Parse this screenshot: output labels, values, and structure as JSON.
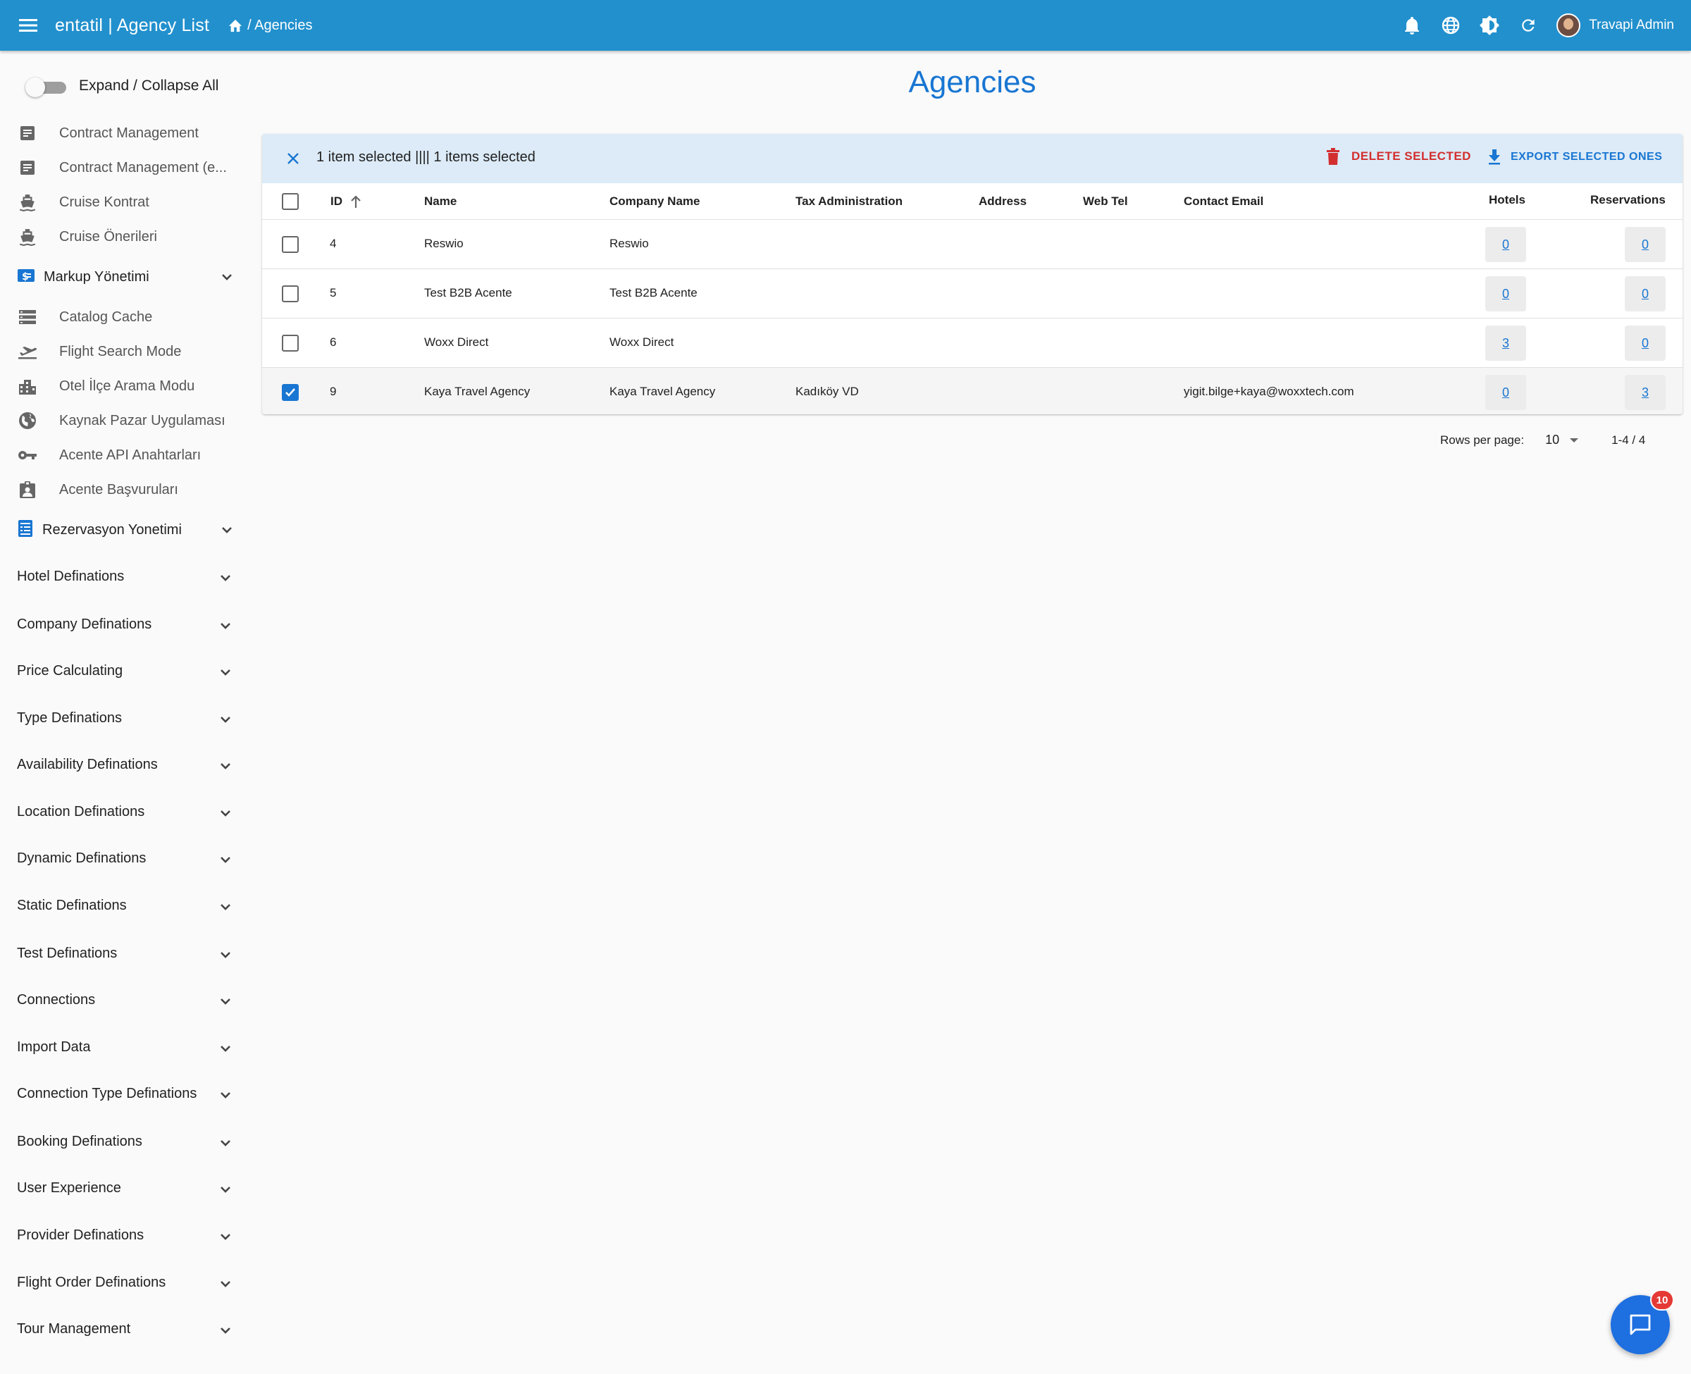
{
  "appbar": {
    "title": "entatil | Agency List",
    "breadcrumb": "/ Agencies",
    "user_name": "Travapi Admin",
    "icons": [
      "menu-icon",
      "home-icon",
      "bell-icon",
      "globe-icon",
      "brightness-icon",
      "refresh-icon",
      "avatar"
    ]
  },
  "sidebar": {
    "toggle_label": "Expand / Collapse All",
    "items": [
      {
        "label": "Contract Management",
        "icon": "contract-icon"
      },
      {
        "label": "Contract Management (e...",
        "icon": "contract-icon"
      },
      {
        "label": "Cruise Kontrat",
        "icon": "ship-icon"
      },
      {
        "label": "Cruise Önerileri",
        "icon": "ship-icon"
      },
      {
        "label": "Markup Yönetimi",
        "icon": "currency-icon",
        "group": true
      },
      {
        "label": "Catalog Cache",
        "icon": "storage-icon"
      },
      {
        "label": "Flight Search Mode",
        "icon": "flight-takeoff-icon"
      },
      {
        "label": "Otel İlçe Arama Modu",
        "icon": "city-icon"
      },
      {
        "label": "Kaynak Pazar Uygulaması",
        "icon": "globe-icon"
      },
      {
        "label": "Acente API Anahtarları",
        "icon": "key-icon"
      },
      {
        "label": "Acente Başvuruları",
        "icon": "badge-icon"
      },
      {
        "label": "Rezervasyon Yonetimi",
        "icon": "receipt-icon",
        "group": true
      }
    ],
    "sections": [
      "Hotel Definations",
      "Company Definations",
      "Price Calculating",
      "Type Definations",
      "Availability Definations",
      "Location Definations",
      "Dynamic Definations",
      "Static Definations",
      "Test Definations",
      "Connections",
      "Import Data",
      "Connection Type Definations",
      "Booking Definations",
      "User Experience",
      "Provider Definations",
      "Flight Order Definations",
      "Tour Management"
    ]
  },
  "main": {
    "title": "Agencies",
    "selection_text": "1 item selected |||| 1 items selected",
    "delete_label": "DELETE SELECTED",
    "export_label": "EXPORT SELECTED ONES",
    "columns": [
      "ID",
      "Name",
      "Company Name",
      "Tax Administration",
      "Address",
      "Web Tel",
      "Contact Email",
      "Hotels",
      "Reservations"
    ],
    "rows": [
      {
        "id": "4",
        "name": "Reswio",
        "company": "Reswio",
        "tax": "",
        "address": "",
        "webtel": "",
        "email": "",
        "hotels": "0",
        "reservations": "0",
        "checked": false
      },
      {
        "id": "5",
        "name": "Test B2B Acente",
        "company": "Test B2B Acente",
        "tax": "",
        "address": "",
        "webtel": "",
        "email": "",
        "hotels": "0",
        "reservations": "0",
        "checked": false
      },
      {
        "id": "6",
        "name": "Woxx Direct",
        "company": "Woxx Direct",
        "tax": "",
        "address": "",
        "webtel": "",
        "email": "",
        "hotels": "3",
        "reservations": "0",
        "checked": false
      },
      {
        "id": "9",
        "name": "Kaya Travel Agency",
        "company": "Kaya Travel Agency",
        "tax": "Kadıköy VD",
        "address": "",
        "webtel": "",
        "email": "yigit.bilge+kaya@woxxtech.com",
        "hotels": "0",
        "reservations": "3",
        "checked": true
      }
    ],
    "pagination": {
      "rows_per_page_label": "Rows per page:",
      "rows_per_page": "10",
      "range": "1-4 / 4"
    }
  },
  "chat": {
    "badge": "10"
  },
  "colors": {
    "appbar": "#2290cd",
    "accent": "#1976d2",
    "danger": "#d32f2f",
    "selection_bar": "#dcebf7"
  }
}
